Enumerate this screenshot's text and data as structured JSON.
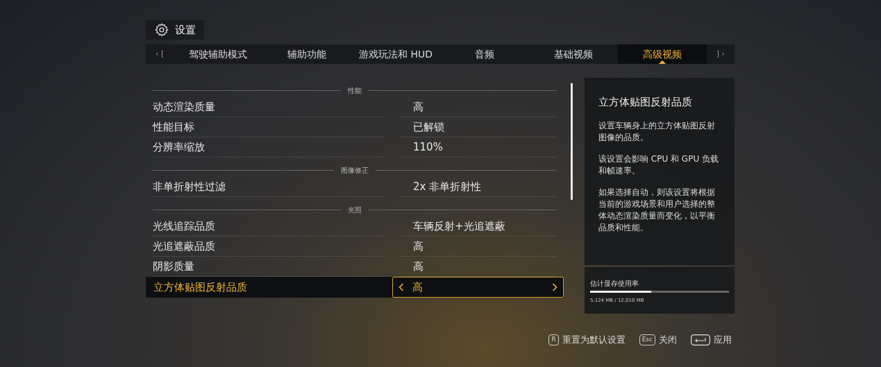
{
  "header": {
    "title": "设置"
  },
  "tab_bar": {
    "prev_hint": "‹ [",
    "next_hint": "] ›",
    "tabs": [
      {
        "label": "驾驶辅助模式",
        "selected": false
      },
      {
        "label": "辅助功能",
        "selected": false
      },
      {
        "label": "游戏玩法和 HUD",
        "selected": false
      },
      {
        "label": "音频",
        "selected": false
      },
      {
        "label": "基础视频",
        "selected": false
      },
      {
        "label": "高级视频",
        "selected": true
      }
    ]
  },
  "sections": [
    {
      "title": "性能",
      "rows": [
        {
          "label": "动态渲染质量",
          "value": "高",
          "selected": false
        },
        {
          "label": "性能目标",
          "value": "已解锁",
          "selected": false
        },
        {
          "label": "分辨率缩放",
          "value": "110%",
          "selected": false
        }
      ]
    },
    {
      "title": "图像修正",
      "rows": [
        {
          "label": "非单折射性过滤",
          "value": "2x 非单折射性",
          "selected": false
        }
      ]
    },
    {
      "title": "光照",
      "rows": [
        {
          "label": "光线追踪品质",
          "value": "车辆反射+光追遮蔽",
          "selected": false
        },
        {
          "label": "光追遮蔽品质",
          "value": "高",
          "selected": false
        },
        {
          "label": "阴影质量",
          "value": "高",
          "selected": false
        },
        {
          "label": "立方体贴图反射品质",
          "value": "高",
          "selected": true
        }
      ]
    }
  ],
  "description": {
    "title": "立方体贴图反射品质",
    "paragraphs": [
      "设置车辆身上的立方体贴图反射图像的品质。",
      "该设置会影响 CPU 和 GPU 负载和帧速率。",
      "如果选择自动，则该设置将根据当前的游戏场景和用户选择的整体动态渲染质量而变化，以平衡品质和性能。"
    ]
  },
  "memory": {
    "label": "估计显存使用率",
    "level": 0.44,
    "reading": "5,124 MB / 12,010 MB"
  },
  "footer": [
    {
      "key": "R",
      "kind": "letter",
      "label": "重置为默认设置"
    },
    {
      "key": "Esc",
      "kind": "letter",
      "label": "关闭"
    },
    {
      "kind": "enter",
      "label": "应用"
    }
  ]
}
